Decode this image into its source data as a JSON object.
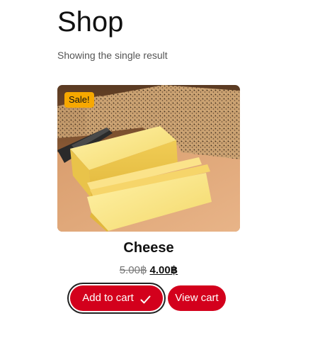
{
  "page": {
    "title": "Shop",
    "result_count": "Showing the single result"
  },
  "product": {
    "name": "Cheese",
    "badge": "Sale!",
    "price_regular": "5.00฿",
    "price_sale": "4.00฿",
    "image_icon": "cheese-photo",
    "add_to_cart_label": "Add to cart",
    "added_icon": "check-icon",
    "view_cart_label": "View cart"
  },
  "colors": {
    "accent": "#d3001c",
    "badge": "#f7a800"
  }
}
